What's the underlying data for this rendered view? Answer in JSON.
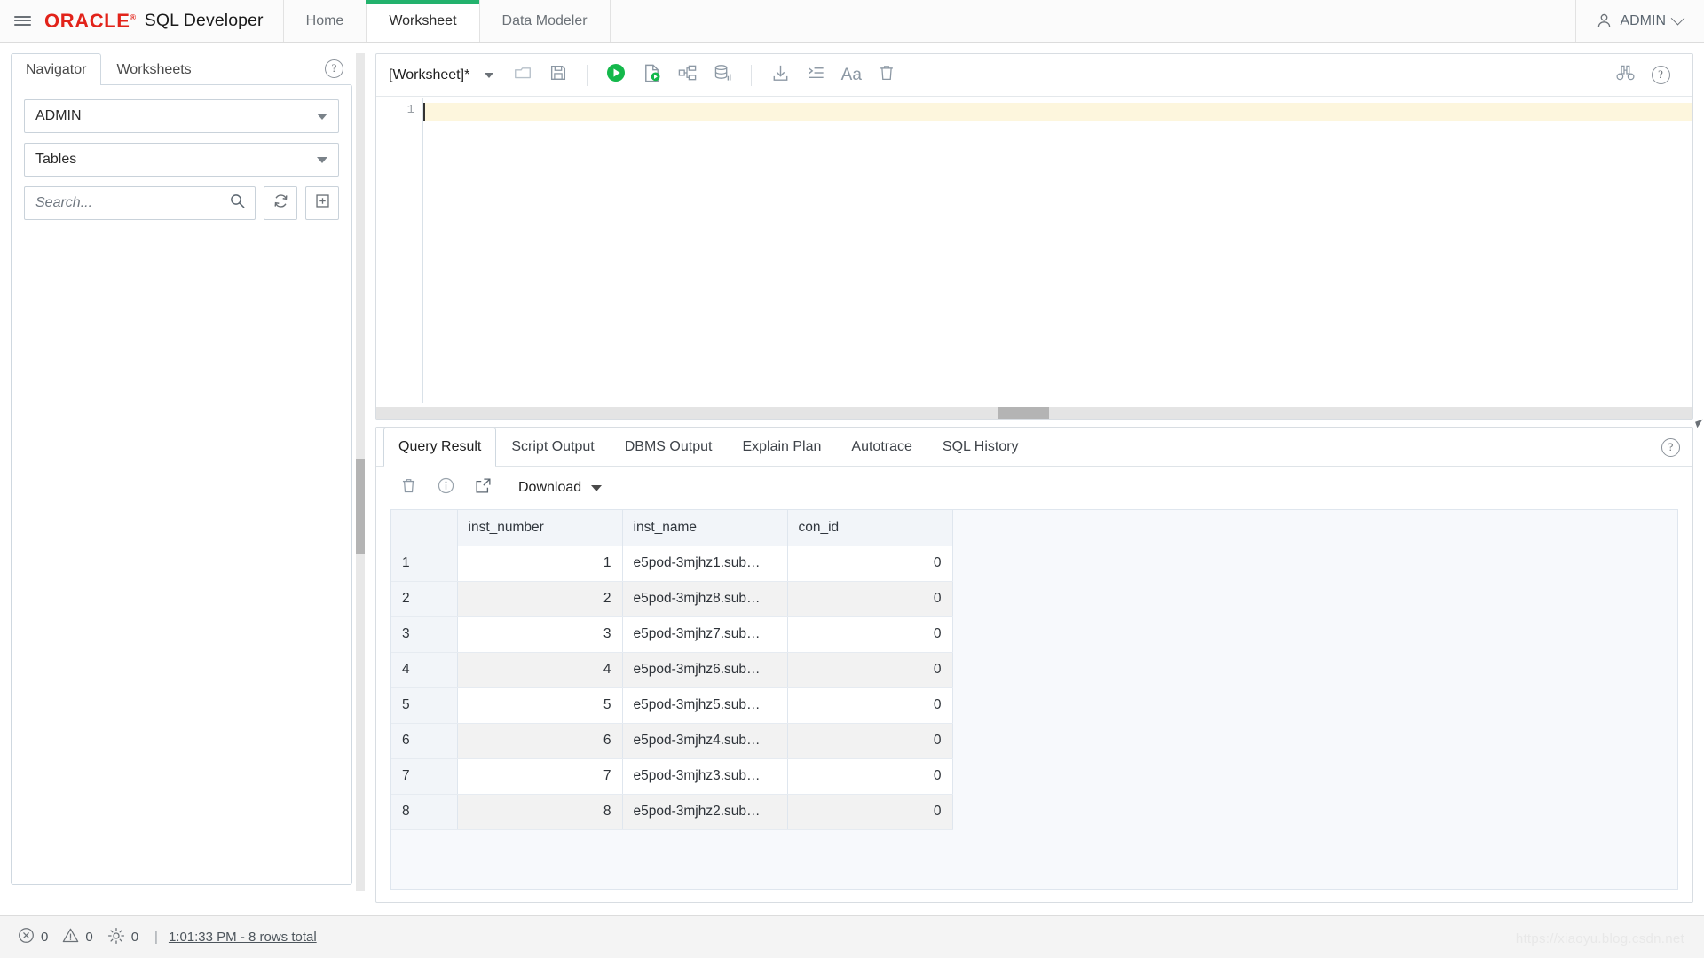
{
  "header": {
    "menu_icon": "hamburger-icon",
    "brand": "ORACLE",
    "brand_mark": "®",
    "product": "SQL Developer",
    "tabs": [
      {
        "label": "Home",
        "active": false
      },
      {
        "label": "Worksheet",
        "active": true
      },
      {
        "label": "Data Modeler",
        "active": false
      }
    ],
    "user": "ADMIN",
    "user_icon": "person-icon",
    "user_caret_icon": "chevron-down-icon",
    "accent_color": "#23b26d",
    "brand_color": "#e2231a"
  },
  "left_panel": {
    "tabs": [
      {
        "label": "Navigator",
        "active": true
      },
      {
        "label": "Worksheets",
        "active": false
      }
    ],
    "help_icon": "help-circle-icon",
    "schema_select": {
      "value": "ADMIN",
      "caret_icon": "caret-down-icon"
    },
    "object_select": {
      "value": "Tables",
      "caret_icon": "caret-down-icon"
    },
    "search": {
      "placeholder": "Search...",
      "value": "",
      "icon": "search-icon"
    },
    "refresh_icon": "refresh-icon",
    "new_object_icon": "plus-box-icon"
  },
  "worksheet": {
    "name": "[Worksheet]*",
    "name_caret_icon": "caret-down-icon",
    "toolbar": [
      {
        "name": "open-file-button",
        "icon": "open-folder-icon"
      },
      {
        "name": "save-button",
        "icon": "save-disk-icon"
      },
      {
        "name": "run-statement-button",
        "icon": "run-play-icon"
      },
      {
        "name": "run-script-button",
        "icon": "run-script-icon"
      },
      {
        "name": "explain-plan-button",
        "icon": "explain-plan-icon"
      },
      {
        "name": "autotrace-button",
        "icon": "autotrace-db-icon"
      },
      {
        "name": "commit-button",
        "icon": "download-arrow-icon"
      },
      {
        "name": "format-sql-button",
        "icon": "format-indent-icon"
      },
      {
        "name": "change-case-button",
        "icon": "text-case-icon"
      },
      {
        "name": "clear-worksheet-button",
        "icon": "trash-icon"
      }
    ],
    "find_icon": "binoculars-icon",
    "help_icon": "help-circle-icon",
    "editor": {
      "line_numbers": [
        "1"
      ],
      "content": "",
      "current_line_highlight": "#fdf6dd"
    }
  },
  "results": {
    "tabs": [
      {
        "label": "Query Result",
        "active": true
      },
      {
        "label": "Script Output",
        "active": false
      },
      {
        "label": "DBMS Output",
        "active": false
      },
      {
        "label": "Explain Plan",
        "active": false
      },
      {
        "label": "Autotrace",
        "active": false
      },
      {
        "label": "SQL History",
        "active": false
      }
    ],
    "help_icon": "help-circle-icon",
    "toolbar": [
      {
        "name": "clear-results-button",
        "icon": "trash-icon"
      },
      {
        "name": "result-info-button",
        "icon": "info-circle-icon"
      },
      {
        "name": "open-in-new-window-button",
        "icon": "external-link-icon"
      }
    ],
    "download_label": "Download",
    "download_caret_icon": "caret-down-icon",
    "grid": {
      "row_header": "",
      "columns": [
        "inst_number",
        "inst_name",
        "con_id"
      ],
      "rows": [
        {
          "n": "1",
          "inst_number": "1",
          "inst_name": "e5pod-3mjhz1.sub…",
          "con_id": "0"
        },
        {
          "n": "2",
          "inst_number": "2",
          "inst_name": "e5pod-3mjhz8.sub…",
          "con_id": "0"
        },
        {
          "n": "3",
          "inst_number": "3",
          "inst_name": "e5pod-3mjhz7.sub…",
          "con_id": "0"
        },
        {
          "n": "4",
          "inst_number": "4",
          "inst_name": "e5pod-3mjhz6.sub…",
          "con_id": "0"
        },
        {
          "n": "5",
          "inst_number": "5",
          "inst_name": "e5pod-3mjhz5.sub…",
          "con_id": "0"
        },
        {
          "n": "6",
          "inst_number": "6",
          "inst_name": "e5pod-3mjhz4.sub…",
          "con_id": "0"
        },
        {
          "n": "7",
          "inst_number": "7",
          "inst_name": "e5pod-3mjhz3.sub…",
          "con_id": "0"
        },
        {
          "n": "8",
          "inst_number": "8",
          "inst_name": "e5pod-3mjhz2.sub…",
          "con_id": "0"
        }
      ]
    }
  },
  "status_bar": {
    "error_icon": "error-circle-x-icon",
    "error_count": "0",
    "warning_icon": "warning-triangle-icon",
    "warning_count": "0",
    "settings_icon": "gear-icon",
    "settings_count": "0",
    "divider": "|",
    "status_text": "1:01:33 PM - 8 rows total"
  },
  "watermark": "https://xiaoyu.blog.csdn.net"
}
